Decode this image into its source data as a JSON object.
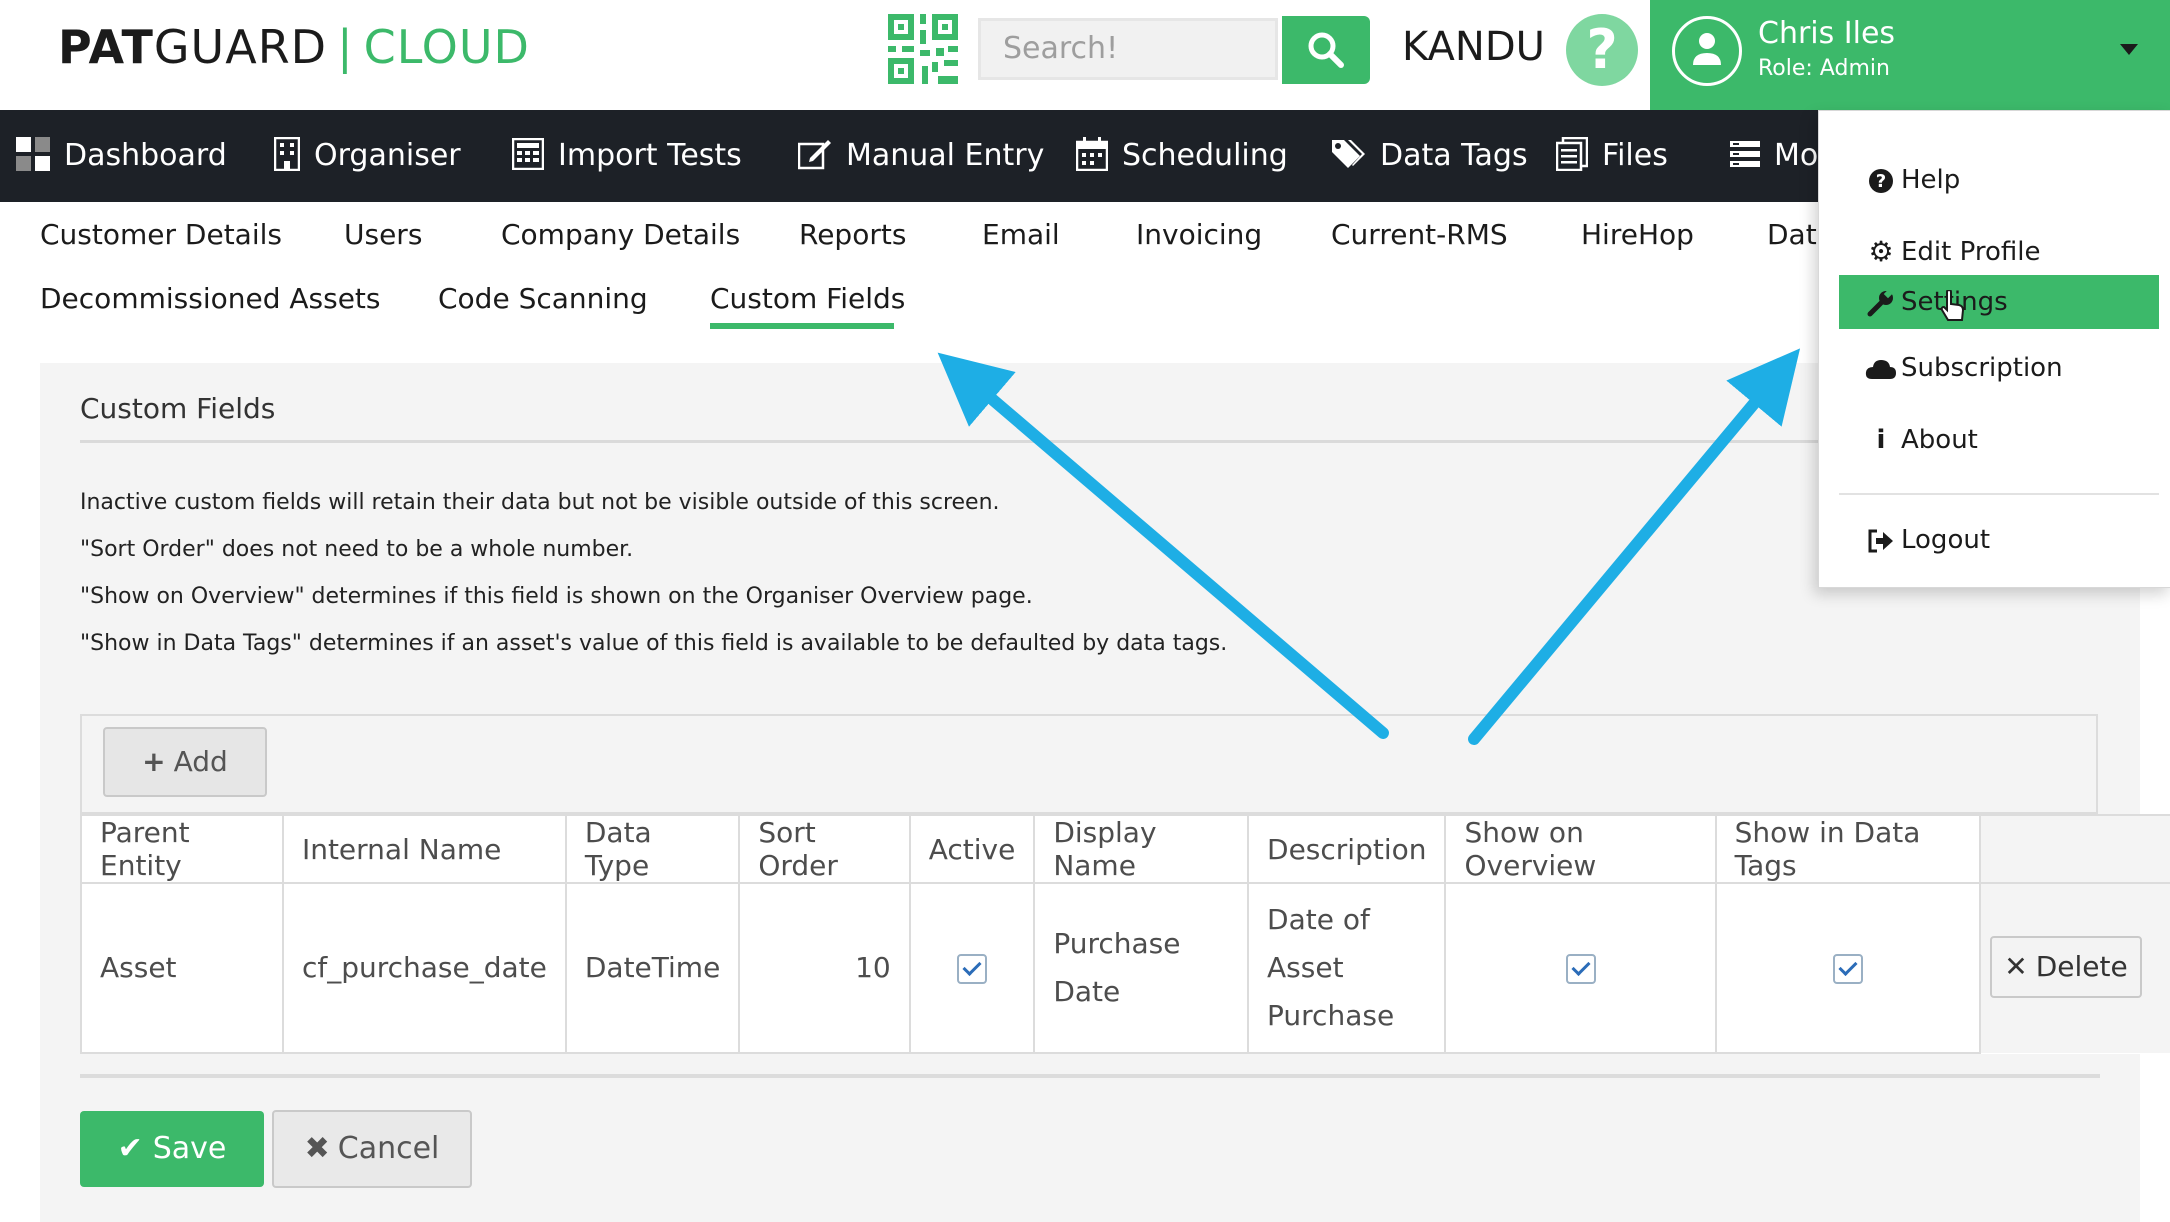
{
  "header": {
    "logo_bold": "PAT",
    "logo_rest": "GUARD",
    "logo_sep": "|",
    "logo_cloud": "CLOUD",
    "search_placeholder": "Search!",
    "company": "KANDU",
    "help_glyph": "?",
    "user_name": "Chris Iles",
    "user_role": "Role: Admin"
  },
  "nav": {
    "items": [
      {
        "label": "Dashboard",
        "icon": "dashboard-icon"
      },
      {
        "label": "Organiser",
        "icon": "building-icon"
      },
      {
        "label": "Import Tests",
        "icon": "calculator-icon"
      },
      {
        "label": "Manual Entry",
        "icon": "edit-icon"
      },
      {
        "label": "Scheduling",
        "icon": "calendar-icon"
      },
      {
        "label": "Data Tags",
        "icon": "tags-icon"
      },
      {
        "label": "Files",
        "icon": "files-icon"
      },
      {
        "label": "Mor",
        "icon": "more-icon"
      }
    ]
  },
  "tabs": {
    "row1": [
      "Customer Details",
      "Users",
      "Company Details",
      "Reports",
      "Email",
      "Invoicing",
      "Current-RMS",
      "HireHop",
      "Data"
    ],
    "row2": [
      "Decommissioned Assets",
      "Code Scanning",
      "Custom Fields"
    ],
    "active": "Custom Fields"
  },
  "panel": {
    "title": "Custom Fields",
    "notes": [
      "Inactive custom fields will retain their data but not be visible outside of this screen.",
      "\"Sort Order\" does not need to be a whole number.",
      "\"Show on Overview\" determines if this field is shown on the Organiser Overview page.",
      "\"Show in Data Tags\" determines if an asset's value of this field is available to be defaulted by data tags."
    ],
    "add_label": "Add"
  },
  "table": {
    "columns": [
      "Parent Entity",
      "Internal Name",
      "Data Type",
      "Sort Order",
      "Active",
      "Display Name",
      "Description",
      "Show on Overview",
      "Show in Data Tags"
    ],
    "rows": [
      {
        "parent_entity": "Asset",
        "internal_name": "cf_purchase_date",
        "data_type": "DateTime",
        "sort_order": "10",
        "active": true,
        "display_name": "Purchase Date",
        "description": "Date of Asset Purchase",
        "show_on_overview": true,
        "show_in_data_tags": true,
        "delete_label": "Delete"
      }
    ]
  },
  "footer": {
    "save_label": "Save",
    "cancel_label": "Cancel"
  },
  "dropdown": {
    "items": [
      {
        "label": "Help",
        "icon": "question-circle-icon"
      },
      {
        "label": "Edit Profile",
        "icon": "gear-icon"
      },
      {
        "label": "Settings",
        "icon": "wrench-icon",
        "active": true
      },
      {
        "label": "Subscription",
        "icon": "cloud-icon"
      },
      {
        "label": "About",
        "icon": "info-icon"
      },
      {
        "label": "Logout",
        "icon": "logout-icon"
      }
    ]
  },
  "colors": {
    "brand_green": "#3cb96a",
    "nav_dark": "#1d2127",
    "arrow_blue": "#1eaee5"
  }
}
